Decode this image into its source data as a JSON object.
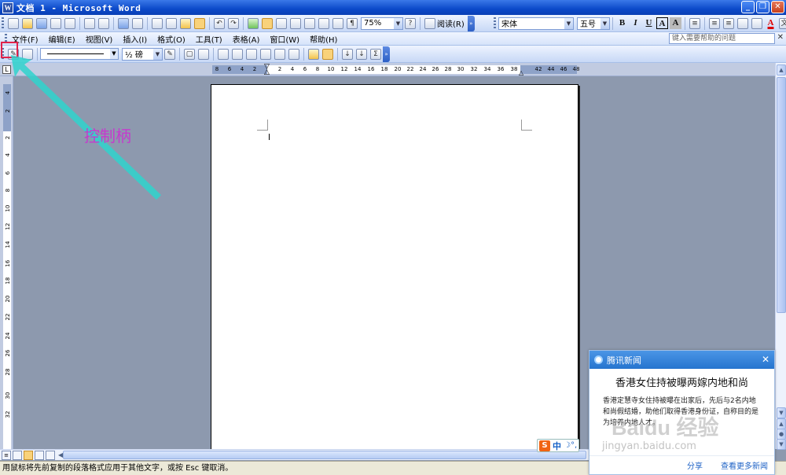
{
  "window": {
    "title": "文档 1 - Microsoft Word"
  },
  "menu": [
    "文件(F)",
    "编辑(E)",
    "视图(V)",
    "插入(I)",
    "格式(O)",
    "工具(T)",
    "表格(A)",
    "窗口(W)",
    "帮助(H)"
  ],
  "help_box": {
    "placeholder": "键入需要帮助的问题"
  },
  "standard_toolbar": {
    "zoom": "75%",
    "read_label": "阅读(R)"
  },
  "formatting_toolbar": {
    "font": "宋体",
    "size": "五号",
    "bold": "B",
    "italic": "I",
    "underline": "U",
    "border_a": "A",
    "char_shade": "A"
  },
  "drawing_toolbar": {
    "line_weight": "½ 磅"
  },
  "ruler": {
    "h_numbers": [
      "8",
      "6",
      "4",
      "2",
      "2",
      "4",
      "6",
      "8",
      "10",
      "12",
      "14",
      "16",
      "18",
      "20",
      "22",
      "24",
      "26",
      "28",
      "30",
      "32",
      "34",
      "36",
      "38",
      "42",
      "44",
      "46",
      "48"
    ],
    "v_numbers": [
      "4",
      "2",
      "2",
      "4",
      "6",
      "8",
      "10",
      "12",
      "14",
      "16",
      "18",
      "20",
      "22",
      "24",
      "26",
      "28",
      "30",
      "32"
    ]
  },
  "annotation": {
    "label": "控制柄",
    "color": "#c53acd",
    "box_color": "#e0234a",
    "arrow_color": "#2fd4cc"
  },
  "ime": {
    "brand": "S",
    "mode": "中"
  },
  "news_popup": {
    "app": "腾讯新闻",
    "headline": "香港女住持被曝两嫁内地和尚",
    "body": "香港定慧寺女住持被曝在出家后，先后与2名内地和尚假结婚，助他们取得香港身份证，自称目的是为培养内地人才。",
    "share": "分享",
    "more": "查看更多新闻"
  },
  "watermark": {
    "logo": "Baidu 经验",
    "url": "jingyan.baidu.com"
  },
  "status": {
    "text": "用鼠标将先前复制的段落格式应用于其他文字，或按 Esc 键取消。"
  }
}
